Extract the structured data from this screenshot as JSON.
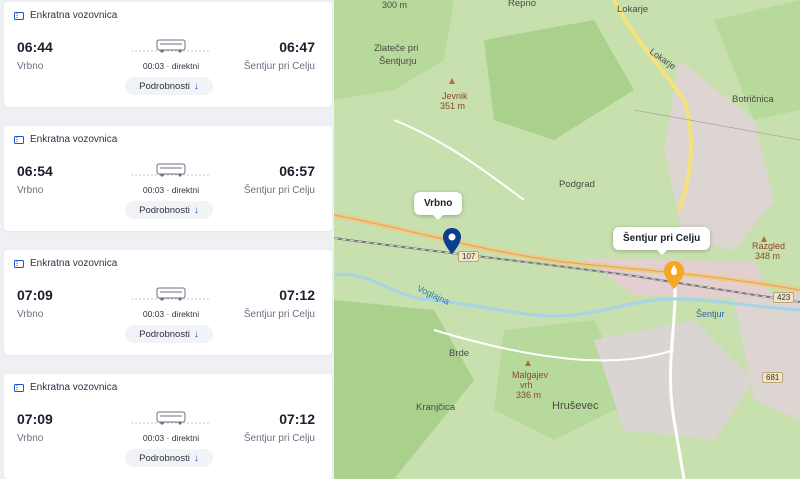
{
  "trips": [
    {
      "ticket": "Enkratna vozovnica",
      "dep_time": "06:44",
      "dep_stop": "Vrbno",
      "arr_time": "06:47",
      "arr_stop": "Šentjur pri Celju",
      "duration": "00:03 · direktni",
      "details": "Podrobnosti"
    },
    {
      "ticket": "Enkratna vozovnica",
      "dep_time": "06:54",
      "dep_stop": "Vrbno",
      "arr_time": "06:57",
      "arr_stop": "Šentjur pri Celju",
      "duration": "00:03 · direktni",
      "details": "Podrobnosti"
    },
    {
      "ticket": "Enkratna vozovnica",
      "dep_time": "07:09",
      "dep_stop": "Vrbno",
      "arr_time": "07:12",
      "arr_stop": "Šentjur pri Celju",
      "duration": "00:03 · direktni",
      "details": "Podrobnosti"
    },
    {
      "ticket": "Enkratna vozovnica",
      "dep_time": "07:09",
      "dep_stop": "Vrbno",
      "arr_time": "07:12",
      "arr_stop": "Šentjur pri Celju",
      "duration": "00:03 · direktni",
      "details": "Podrobnosti"
    }
  ],
  "map": {
    "labels": {
      "repno": "Repno",
      "lokarje": "Lokarje",
      "lokarje_road": "Lokarje",
      "zlatece": "Zlateče pri",
      "zlatece2": "Šentjurju",
      "jevnik": "Jevnik",
      "jevnik_alt": "351 m",
      "botricnica": "Botričnica",
      "podgrad": "Podgrad",
      "razgled": "Razgled",
      "razgled_alt": "348 m",
      "sentjur_town": "Šentjur",
      "brde": "Brde",
      "malgajev": "Malgajev",
      "malgajev2": "vrh",
      "malgajev_alt": "336 m",
      "hrusevec": "Hruševec",
      "kranjcica": "Kranjčica",
      "voglajna": "Voglajna",
      "top_alt": "300 m",
      "road_107": "107",
      "road_423": "423",
      "road_681": "681"
    },
    "popup_origin": "Vrbno",
    "popup_dest": "Šentjur pri Celju",
    "origin_color": "#0b3d91",
    "dest_color": "#f5a623"
  },
  "colors": {
    "accent": "#1a56c8"
  }
}
